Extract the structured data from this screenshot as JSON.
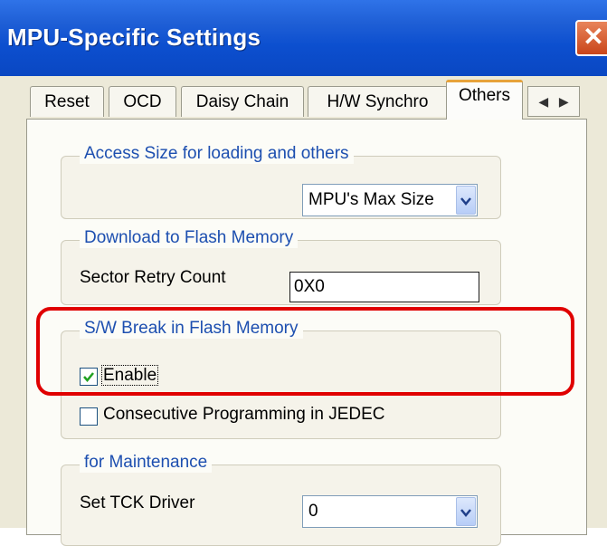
{
  "window": {
    "title": "MPU-Specific Settings",
    "close_icon": "close-icon"
  },
  "tabs": [
    {
      "label": "Reset"
    },
    {
      "label": "OCD"
    },
    {
      "label": "Daisy Chain"
    },
    {
      "label": "H/W Synchro"
    },
    {
      "label": "Others",
      "active": true
    }
  ],
  "tab_scroll": {
    "left": "◀",
    "right": "▶"
  },
  "access_size": {
    "legend": "Access Size for loading and others",
    "selected": "MPU's Max Size"
  },
  "flash_download": {
    "legend": "Download to Flash Memory",
    "retry_label": "Sector Retry Count",
    "retry_value": "0X0"
  },
  "sw_break": {
    "legend": "S/W Break in Flash Memory",
    "enable_label": "Enable",
    "enable_checked": true,
    "consecutive_label": "Consecutive Programming in JEDEC",
    "consecutive_checked": false
  },
  "maintenance": {
    "legend": "for Maintenance",
    "tck_label": "Set TCK Driver",
    "tck_value": "0"
  },
  "colors": {
    "titlebar": "#0c4fcf",
    "legend_text": "#1d4fb0",
    "highlight": "#e00000",
    "active_tab_accent": "#e7a33a"
  }
}
